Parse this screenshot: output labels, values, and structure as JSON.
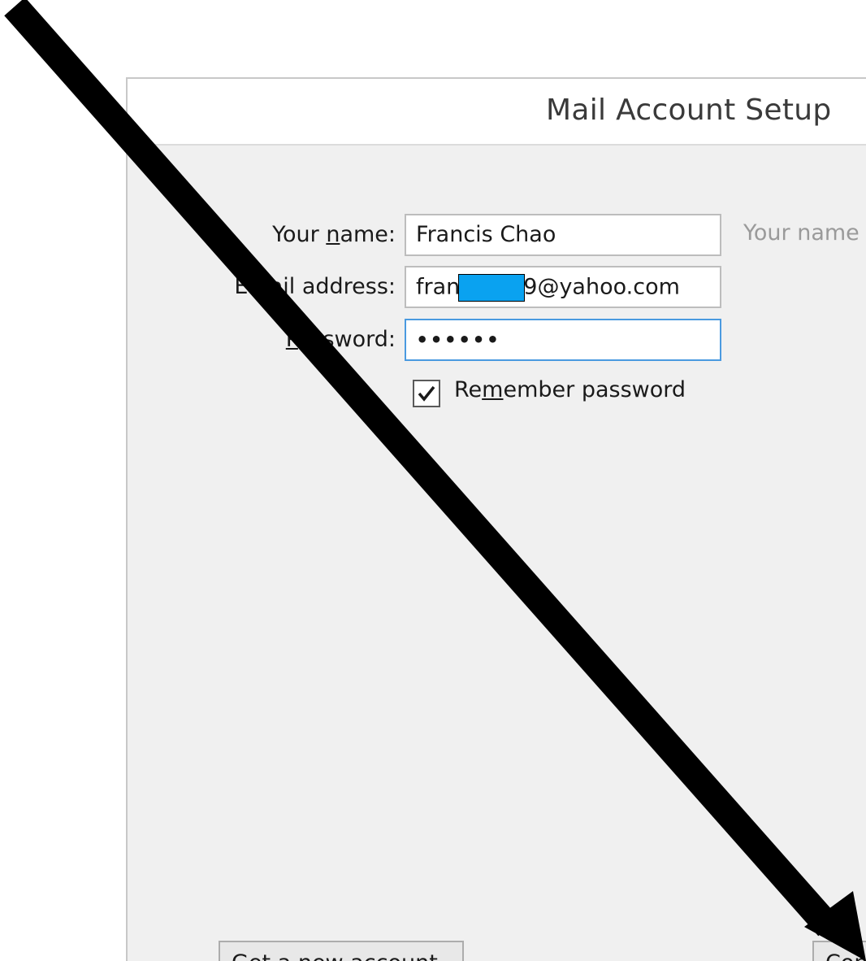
{
  "dialog": {
    "title": "Mail Account Setup",
    "fields": {
      "name": {
        "label_pre": "Your ",
        "label_u": "n",
        "label_post": "ame:",
        "value": "Francis Chao",
        "hint": "Your name"
      },
      "email": {
        "label": "Email address:",
        "value_pre": "fran",
        "value_post": "9@yahoo.com"
      },
      "password": {
        "label_u": "P",
        "label_post": "assword:",
        "value": "••••••"
      }
    },
    "remember": {
      "label_pre": "Re",
      "label_u": "m",
      "label_post": "ember password",
      "checked": true
    },
    "buttons": {
      "left_label": "Get a new account",
      "right_label": "Continue"
    }
  },
  "overlay": {
    "arrow_color": "#000000",
    "redaction_color": "#0aa2f0"
  }
}
